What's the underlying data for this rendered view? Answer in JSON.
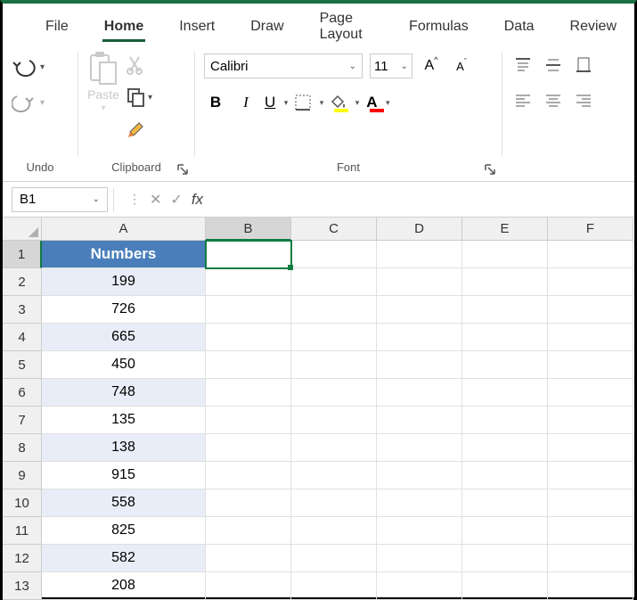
{
  "tabs": [
    "File",
    "Home",
    "Insert",
    "Draw",
    "Page Layout",
    "Formulas",
    "Data",
    "Review"
  ],
  "active_tab": "Home",
  "groups": {
    "undo": "Undo",
    "clipboard": "Clipboard",
    "font": "Font",
    "paste": "Paste"
  },
  "font": {
    "name": "Calibri",
    "size": "11"
  },
  "namebox": "B1",
  "formula": "",
  "columns": [
    "A",
    "B",
    "C",
    "D",
    "E",
    "F"
  ],
  "header_label": "Numbers",
  "values": [
    "199",
    "726",
    "665",
    "450",
    "748",
    "135",
    "138",
    "915",
    "558",
    "825",
    "582",
    "208"
  ],
  "fx_label": "fx",
  "chart_data": {
    "type": "table",
    "columns": [
      "Numbers"
    ],
    "rows": [
      199,
      726,
      665,
      450,
      748,
      135,
      138,
      915,
      558,
      825,
      582,
      208
    ]
  }
}
